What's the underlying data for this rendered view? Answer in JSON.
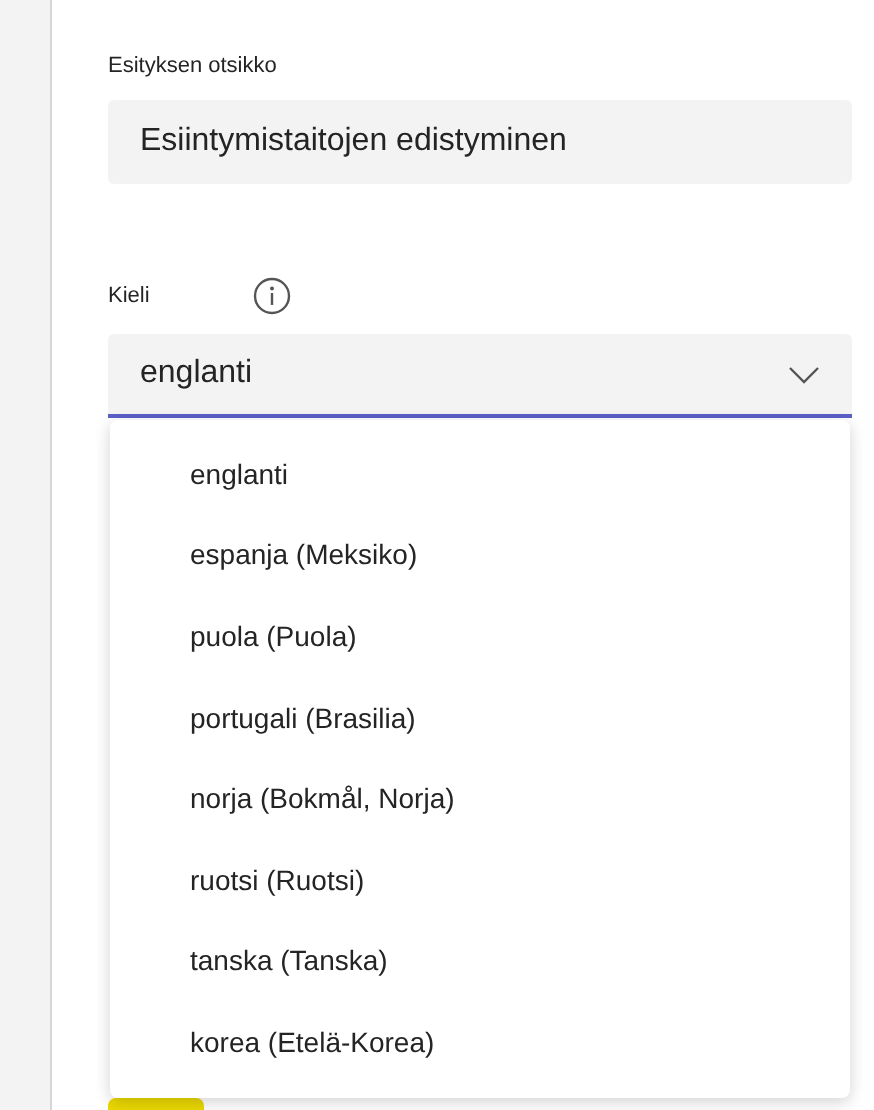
{
  "title_field": {
    "label": "Esityksen otsikko",
    "value": "Esiintymistaitojen edistyminen"
  },
  "language_field": {
    "label": "Kieli",
    "value": "englanti",
    "expanded": true
  },
  "language_options": [
    "englanti",
    "espanja (Meksiko)",
    "puola (Puola)",
    "portugali (Brasilia)",
    "norja (Bokmål, Norja)",
    "ruotsi (Ruotsi)",
    "tanska (Tanska)",
    "korea (Etelä-Korea)"
  ]
}
